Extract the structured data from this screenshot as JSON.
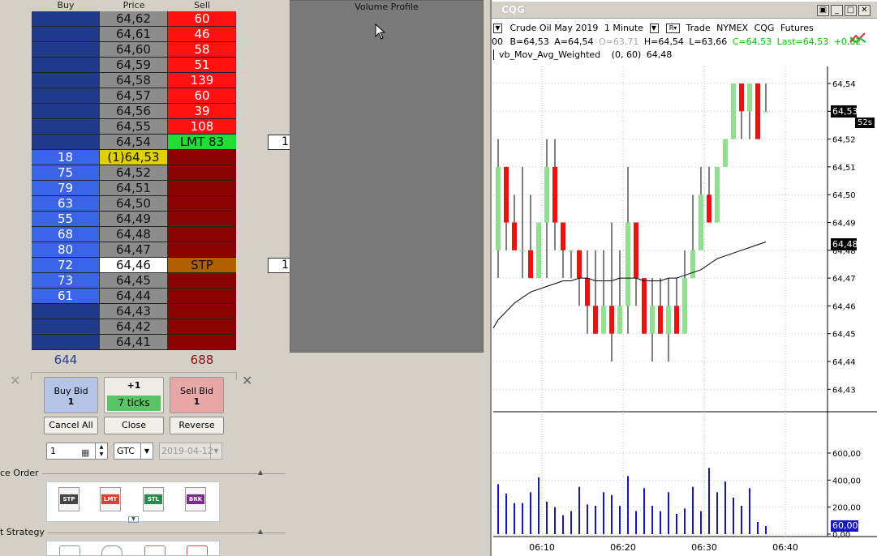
{
  "ladder": {
    "headers": {
      "buy": "Buy",
      "price": "Price",
      "sell": "Sell"
    },
    "rows": [
      {
        "buy": "",
        "price": "64,62",
        "sell": "60",
        "kind": "ask"
      },
      {
        "buy": "",
        "price": "64,61",
        "sell": "46",
        "kind": "ask"
      },
      {
        "buy": "",
        "price": "64,60",
        "sell": "58",
        "kind": "ask"
      },
      {
        "buy": "",
        "price": "64,59",
        "sell": "51",
        "kind": "ask"
      },
      {
        "buy": "",
        "price": "64,58",
        "sell": "139",
        "kind": "ask"
      },
      {
        "buy": "",
        "price": "64,57",
        "sell": "60",
        "kind": "ask"
      },
      {
        "buy": "",
        "price": "64,56",
        "sell": "39",
        "kind": "ask"
      },
      {
        "buy": "",
        "price": "64,55",
        "sell": "108",
        "kind": "ask"
      },
      {
        "buy": "",
        "price": "64,54",
        "sell": "LMT 83",
        "kind": "lmt",
        "order_qty": "1"
      },
      {
        "buy": "18",
        "price": "(1)64,53",
        "sell": "",
        "kind": "last"
      },
      {
        "buy": "75",
        "price": "64,52",
        "sell": "",
        "kind": "bid"
      },
      {
        "buy": "79",
        "price": "64,51",
        "sell": "",
        "kind": "bid"
      },
      {
        "buy": "63",
        "price": "64,50",
        "sell": "",
        "kind": "bid"
      },
      {
        "buy": "55",
        "price": "64,49",
        "sell": "",
        "kind": "bid"
      },
      {
        "buy": "68",
        "price": "64,48",
        "sell": "",
        "kind": "bid"
      },
      {
        "buy": "80",
        "price": "64,47",
        "sell": "",
        "kind": "bid"
      },
      {
        "buy": "72",
        "price": "64,46",
        "sell": "STP",
        "kind": "stp",
        "order_qty": "1"
      },
      {
        "buy": "73",
        "price": "64,45",
        "sell": "",
        "kind": "bid"
      },
      {
        "buy": "61",
        "price": "64,44",
        "sell": "",
        "kind": "bid"
      },
      {
        "buy": "",
        "price": "64,43",
        "sell": "",
        "kind": "deep"
      },
      {
        "buy": "",
        "price": "64,42",
        "sell": "",
        "kind": "deep"
      },
      {
        "buy": "",
        "price": "64,41",
        "sell": "",
        "kind": "deep"
      }
    ],
    "total_buy": "644",
    "total_sell": "688",
    "close_glyph": "✕"
  },
  "volume_profile": {
    "title": "Volume Profile"
  },
  "controls": {
    "buy_bid": {
      "line1": "Buy Bid",
      "line2": "1"
    },
    "offset": {
      "plus": "+1",
      "ticks": "7 ticks"
    },
    "sell_bid": {
      "line1": "Sell Bid",
      "line2": "1"
    },
    "cancel_all": "Cancel All",
    "close": "Close",
    "reverse": "Reverse",
    "quantity": "1",
    "duration": "GTC",
    "date": "2019-04-12",
    "place_order_label": "ce Order",
    "strategy_label": "t Strategy",
    "order_tiles": [
      "STP",
      "LMT",
      "STL",
      "BRK"
    ]
  },
  "chart": {
    "window_title": "CQG",
    "symbol": "Crude Oil May 2019",
    "interval": "1 Minute",
    "mode": "Trade",
    "exchange": "NYMEX",
    "vendor": "CQG",
    "type": "Futures",
    "quote_time": "00",
    "bid": "B=64,53",
    "ask": "A=64,54",
    "open": "O=63,71",
    "high": "H=64,54",
    "low": "L=63,66",
    "close_q": "C=64,53",
    "last": "Last=64,53",
    "change": "+0,82",
    "study_name": "vb_Mov_Avg_Weighted",
    "study_params": "(0, 60)",
    "study_value": "64,48",
    "last_price_tag": "64,53",
    "countdown": "52s",
    "ma_price_tag": "64,48",
    "volume_tag": "60,00",
    "colors": {
      "up": "#90e090",
      "down": "#ee1111",
      "volume": "#1515cc",
      "ma": "#000000"
    }
  },
  "chart_data": {
    "type": "bar",
    "price_axis": {
      "ticks": [
        "64,54",
        "64,53",
        "64,52",
        "64,51",
        "64,50",
        "64,49",
        "64,48",
        "64,47",
        "64,46",
        "64,45",
        "64,44",
        "64,43"
      ],
      "ylim": [
        64.425,
        64.545
      ]
    },
    "time_axis": {
      "ticks": [
        "06:10",
        "06:20",
        "06:30",
        "06:40"
      ]
    },
    "volume_axis": {
      "ticks": [
        "600,00",
        "400,00",
        "200,00",
        "0,00"
      ],
      "ylim": [
        0,
        700
      ]
    },
    "candles": [
      {
        "o": 64.48,
        "h": 64.52,
        "l": 64.47,
        "c": 64.51
      },
      {
        "o": 64.51,
        "h": 64.51,
        "l": 64.48,
        "c": 64.49
      },
      {
        "o": 64.49,
        "h": 64.5,
        "l": 64.48,
        "c": 64.48
      },
      {
        "o": 64.48,
        "h": 64.51,
        "l": 64.47,
        "c": 64.48
      },
      {
        "o": 64.48,
        "h": 64.5,
        "l": 64.47,
        "c": 64.47
      },
      {
        "o": 64.47,
        "h": 64.49,
        "l": 64.47,
        "c": 64.49
      },
      {
        "o": 64.49,
        "h": 64.52,
        "l": 64.47,
        "c": 64.51
      },
      {
        "o": 64.51,
        "h": 64.52,
        "l": 64.48,
        "c": 64.49
      },
      {
        "o": 64.49,
        "h": 64.49,
        "l": 64.47,
        "c": 64.48
      },
      {
        "o": 64.48,
        "h": 64.48,
        "l": 64.47,
        "c": 64.48
      },
      {
        "o": 64.48,
        "h": 64.48,
        "l": 64.46,
        "c": 64.47
      },
      {
        "o": 64.47,
        "h": 64.48,
        "l": 64.45,
        "c": 64.46
      },
      {
        "o": 64.46,
        "h": 64.48,
        "l": 64.45,
        "c": 64.45
      },
      {
        "o": 64.45,
        "h": 64.48,
        "l": 64.45,
        "c": 64.46
      },
      {
        "o": 64.46,
        "h": 64.49,
        "l": 64.44,
        "c": 64.45
      },
      {
        "o": 64.45,
        "h": 64.48,
        "l": 64.45,
        "c": 64.46
      },
      {
        "o": 64.46,
        "h": 64.51,
        "l": 64.45,
        "c": 64.49
      },
      {
        "o": 64.49,
        "h": 64.49,
        "l": 64.46,
        "c": 64.47
      },
      {
        "o": 64.47,
        "h": 64.47,
        "l": 64.45,
        "c": 64.45
      },
      {
        "o": 64.45,
        "h": 64.47,
        "l": 64.44,
        "c": 64.46
      },
      {
        "o": 64.46,
        "h": 64.47,
        "l": 64.45,
        "c": 64.45
      },
      {
        "o": 64.45,
        "h": 64.47,
        "l": 64.44,
        "c": 64.46
      },
      {
        "o": 64.46,
        "h": 64.47,
        "l": 64.45,
        "c": 64.45
      },
      {
        "o": 64.45,
        "h": 64.48,
        "l": 64.45,
        "c": 64.47
      },
      {
        "o": 64.47,
        "h": 64.5,
        "l": 64.47,
        "c": 64.48
      },
      {
        "o": 64.48,
        "h": 64.51,
        "l": 64.48,
        "c": 64.5
      },
      {
        "o": 64.5,
        "h": 64.51,
        "l": 64.49,
        "c": 64.49
      },
      {
        "o": 64.49,
        "h": 64.51,
        "l": 64.49,
        "c": 64.51
      },
      {
        "o": 64.51,
        "h": 64.52,
        "l": 64.51,
        "c": 64.52
      },
      {
        "o": 64.52,
        "h": 64.54,
        "l": 64.52,
        "c": 64.54
      },
      {
        "o": 64.54,
        "h": 64.54,
        "l": 64.52,
        "c": 64.53
      },
      {
        "o": 64.53,
        "h": 64.54,
        "l": 64.52,
        "c": 64.54
      },
      {
        "o": 64.54,
        "h": 64.54,
        "l": 64.52,
        "c": 64.52
      },
      {
        "o": 64.53,
        "h": 64.54,
        "l": 64.53,
        "c": 64.53
      }
    ],
    "volumes": [
      370,
      300,
      230,
      230,
      310,
      420,
      240,
      200,
      140,
      170,
      350,
      220,
      210,
      310,
      290,
      210,
      430,
      170,
      340,
      210,
      170,
      310,
      150,
      190,
      350,
      170,
      490,
      310,
      390,
      270,
      210,
      340,
      90,
      60
    ],
    "ma": [
      64.455,
      64.458,
      64.461,
      64.463,
      64.465,
      64.466,
      64.467,
      64.468,
      64.469,
      64.469,
      64.47,
      64.47,
      64.469,
      64.469,
      64.469,
      64.47,
      64.47,
      64.47,
      64.469,
      64.469,
      64.469,
      64.47,
      64.47,
      64.471,
      64.472,
      64.473,
      64.475,
      64.477,
      64.478,
      64.479,
      64.48,
      64.481,
      64.482,
      64.483
    ]
  }
}
